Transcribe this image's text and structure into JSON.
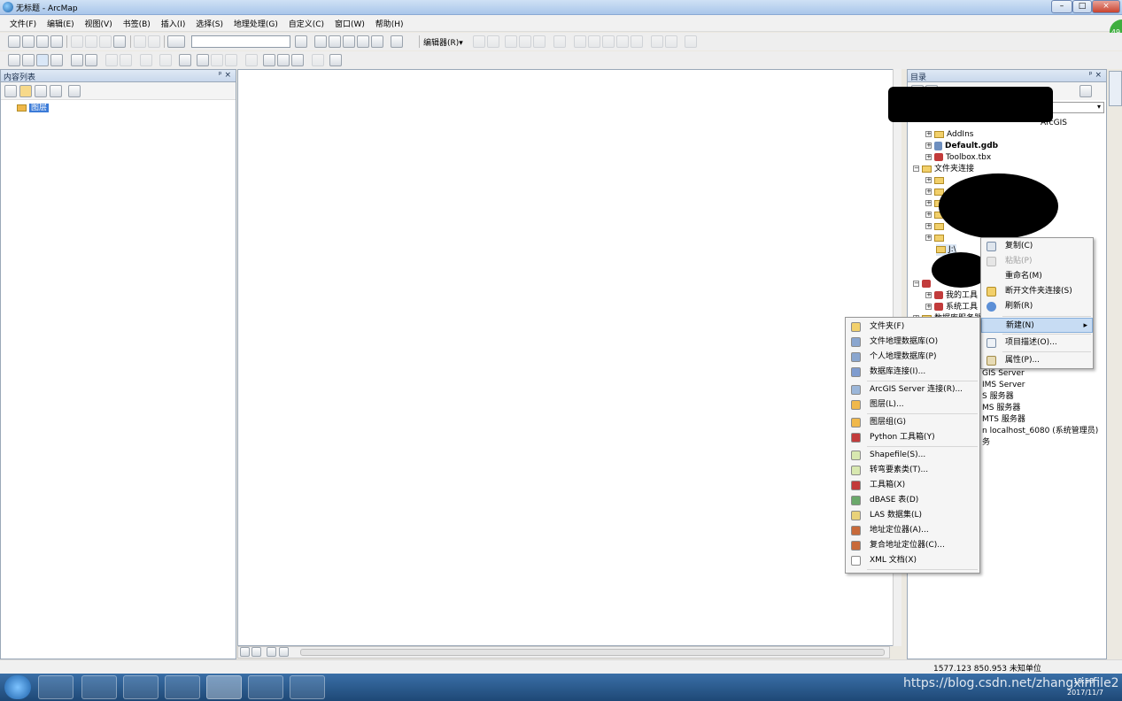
{
  "window": {
    "title": "无标题 - ArcMap"
  },
  "menubar": [
    "文件(F)",
    "编辑(E)",
    "视图(V)",
    "书签(B)",
    "插入(I)",
    "选择(S)",
    "地理处理(G)",
    "自定义(C)",
    "窗口(W)",
    "帮助(H)"
  ],
  "toolbar": {
    "editor_label": "编辑器(R)▾"
  },
  "toc": {
    "title": "内容列表",
    "pin": "ᵖ ×",
    "root": "图层"
  },
  "catalog": {
    "title": "目录",
    "pin": "ᵖ ×",
    "items": [
      {
        "label": "ArcGIS"
      },
      {
        "label": "AddIns"
      },
      {
        "label": "Default.gdb"
      },
      {
        "label": "Toolbox.tbx"
      },
      {
        "label": "文件夹连接"
      },
      {
        "label": "J:\\"
      },
      {
        "label": "我的工具"
      },
      {
        "label": "系统工具"
      },
      {
        "label": "数据库服务器"
      },
      {
        "label": "GIS Server"
      },
      {
        "label": "IMS Server"
      },
      {
        "label": "S 服务器"
      },
      {
        "label": "MS 服务器"
      },
      {
        "label": "MTS 服务器"
      },
      {
        "label": "n localhost_6080 (系统管理员)"
      },
      {
        "label": "务"
      }
    ]
  },
  "context_menu": {
    "items": [
      {
        "label": "复制(C)"
      },
      {
        "label": "粘贴(P)"
      },
      {
        "label": "重命名(M)"
      },
      {
        "label": "断开文件夹连接(S)"
      },
      {
        "label": "刷新(R)"
      },
      {
        "label": "新建(N)"
      },
      {
        "label": "项目描述(O)..."
      },
      {
        "label": "属性(P)..."
      }
    ]
  },
  "new_submenu": {
    "items": [
      {
        "label": "文件夹(F)",
        "icon": "folder-icon",
        "color": "#f2d06b"
      },
      {
        "label": "文件地理数据库(O)",
        "icon": "file-gdb-icon",
        "color": "#8aa6cf"
      },
      {
        "label": "个人地理数据库(P)",
        "icon": "personal-gdb-icon",
        "color": "#8aa6cf"
      },
      {
        "label": "数据库连接(I)...",
        "icon": "db-connection-icon",
        "color": "#7f9ccf"
      },
      {
        "label": "ArcGIS Server 连接(R)...",
        "icon": "server-connection-icon",
        "color": "#9bb6d9"
      },
      {
        "label": "图层(L)...",
        "icon": "layer-icon",
        "color": "#f0b84a"
      },
      {
        "label": "图层组(G)",
        "icon": "group-layer-icon",
        "color": "#f0b84a"
      },
      {
        "label": "Python 工具箱(Y)",
        "icon": "python-toolbox-icon",
        "color": "#c23b3b"
      },
      {
        "label": "Shapefile(S)...",
        "icon": "shapefile-icon",
        "color": "#d8e8b0"
      },
      {
        "label": "转弯要素类(T)...",
        "icon": "turn-feature-icon",
        "color": "#d8e8b0"
      },
      {
        "label": "工具箱(X)",
        "icon": "toolbox-icon",
        "color": "#c23b3b"
      },
      {
        "label": "dBASE 表(D)",
        "icon": "dbase-icon",
        "color": "#6aa86a"
      },
      {
        "label": "LAS 数据集(L)",
        "icon": "las-icon",
        "color": "#e9d27a"
      },
      {
        "label": "地址定位器(A)...",
        "icon": "locator-icon",
        "color": "#c86a3a"
      },
      {
        "label": "复合地址定位器(C)...",
        "icon": "composite-locator-icon",
        "color": "#c86a3a"
      },
      {
        "label": "XML 文档(X)",
        "icon": "xml-icon",
        "color": "#ffffff"
      }
    ]
  },
  "statusbar": {
    "coords": "1577.123  850.953 未知单位"
  },
  "taskbar": {
    "clock_time": "19:58",
    "clock_date": "2017/11/7"
  },
  "watermark": "https://blog.csdn.net/zhangxinfile2",
  "badge": "49"
}
